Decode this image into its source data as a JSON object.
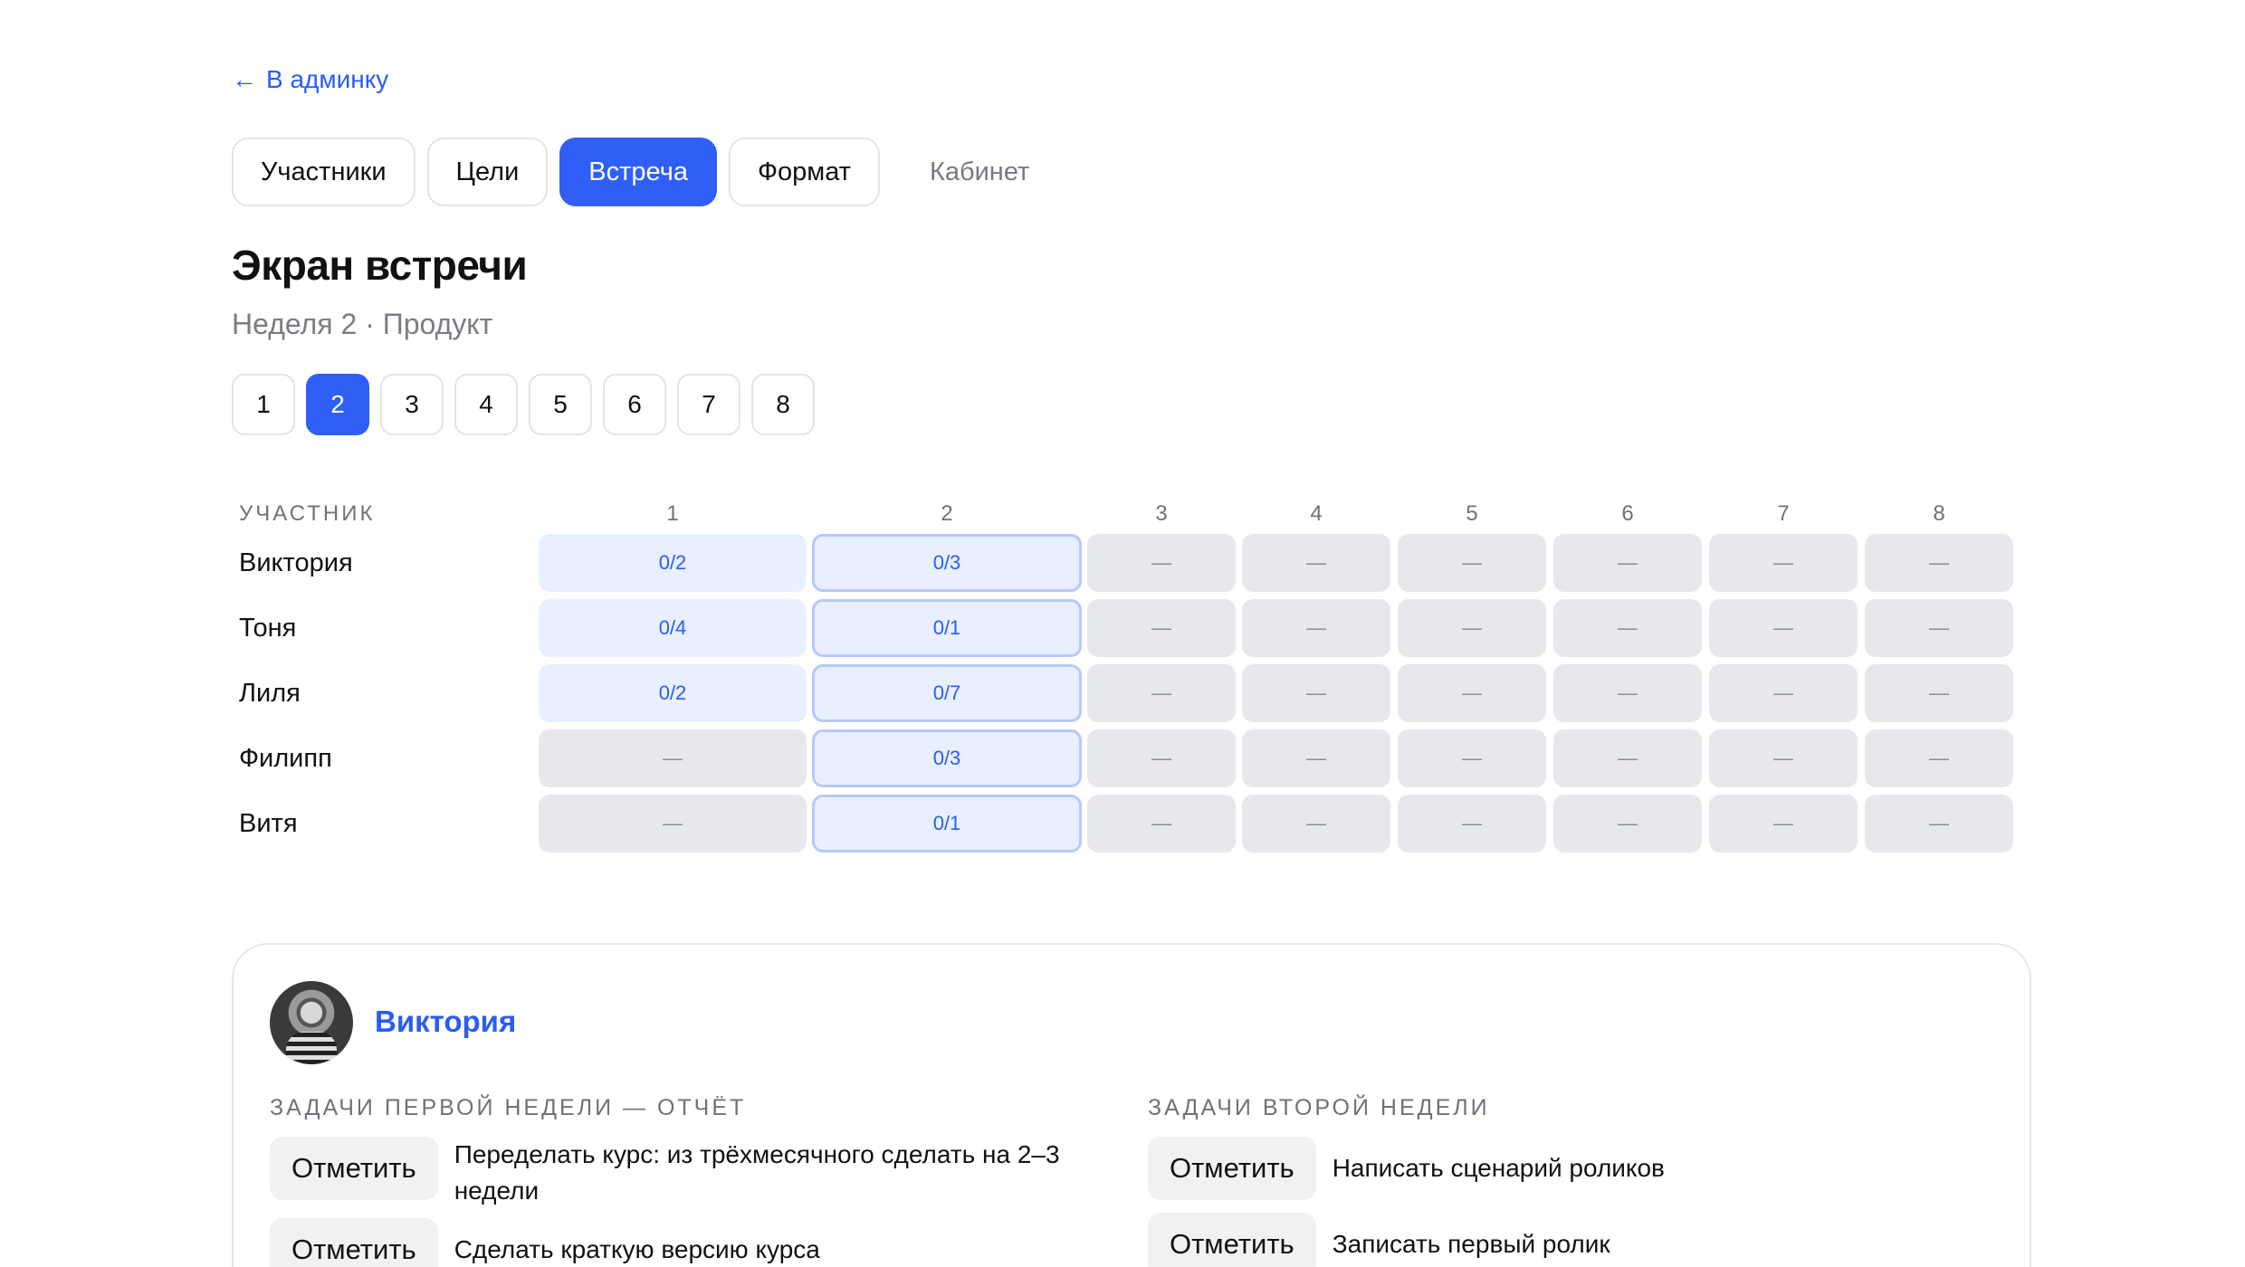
{
  "nav": {
    "back_label": "В админку"
  },
  "tabs": [
    {
      "label": "Участники"
    },
    {
      "label": "Цели"
    },
    {
      "label": "Встреча"
    },
    {
      "label": "Формат"
    },
    {
      "label": "Кабинет"
    }
  ],
  "page": {
    "title": "Экран встречи",
    "subtitle": "Неделя 2 · Продукт"
  },
  "week_selector": [
    "1",
    "2",
    "3",
    "4",
    "5",
    "6",
    "7",
    "8"
  ],
  "selected_week": "2",
  "grid": {
    "participant_header": "УЧАСТНИК",
    "columns": [
      "1",
      "2",
      "3",
      "4",
      "5",
      "6",
      "7",
      "8"
    ],
    "rows": [
      {
        "name": "Виктория",
        "cells": [
          "0/2",
          "0/3",
          "—",
          "—",
          "—",
          "—",
          "—",
          "—"
        ]
      },
      {
        "name": "Тоня",
        "cells": [
          "0/4",
          "0/1",
          "—",
          "—",
          "—",
          "—",
          "—",
          "—"
        ]
      },
      {
        "name": "Лиля",
        "cells": [
          "0/2",
          "0/7",
          "—",
          "—",
          "—",
          "—",
          "—",
          "—"
        ]
      },
      {
        "name": "Филипп",
        "cells": [
          "—",
          "0/3",
          "—",
          "—",
          "—",
          "—",
          "—",
          "—"
        ]
      },
      {
        "name": "Витя",
        "cells": [
          "—",
          "0/1",
          "—",
          "—",
          "—",
          "—",
          "—",
          "—"
        ]
      }
    ]
  },
  "participant_card": {
    "name": "Виктория",
    "week1_header": "ЗАДАЧИ ПЕРВОЙ НЕДЕЛИ — ОТЧЁТ",
    "week2_header": "ЗАДАЧИ ВТОРОЙ НЕДЕЛИ",
    "mark_label": "Отметить",
    "week1_tasks": [
      "Переделать курс: из трёхмесячного сделать на 2–3 недели",
      "Сделать краткую версию курса"
    ],
    "week2_tasks": [
      "Написать сценарий роликов",
      "Записать первый ролик"
    ]
  },
  "colors": {
    "accent": "#2f5ff6",
    "link": "#2a5cf5",
    "cell_filled": "#e8efff",
    "cell_empty": "#e6e8ec"
  }
}
